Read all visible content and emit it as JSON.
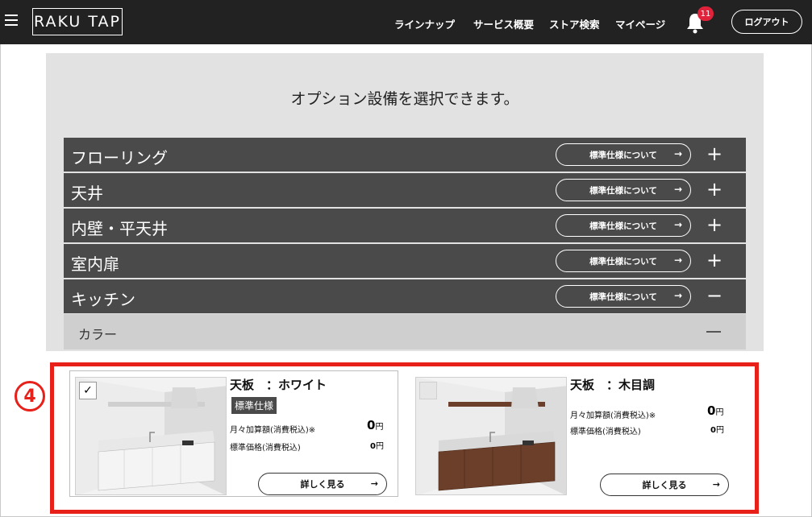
{
  "header": {
    "logo": "RAKU TAP",
    "nav": [
      "ラインナップ",
      "サービス概要",
      "ストア検索",
      "マイページ"
    ],
    "notification_count": "11",
    "logout_label": "ログアウト"
  },
  "main": {
    "intro": "オプション設備を選択できます。",
    "standard_button_label": "標準仕様について",
    "categories": [
      {
        "label": "フローリング",
        "toggle": "+"
      },
      {
        "label": "天井",
        "toggle": "+"
      },
      {
        "label": "内壁・平天井",
        "toggle": "+"
      },
      {
        "label": "室内扉",
        "toggle": "+"
      },
      {
        "label": "キッチン",
        "toggle": "−"
      }
    ],
    "sub_category": {
      "label": "カラー"
    },
    "step_marker": "4"
  },
  "options": [
    {
      "title": "天板　：ホワイト",
      "tag": "標準仕様",
      "checked": true,
      "monthly_label": "月々加算額(消費税込)※",
      "monthly_value": "0",
      "price_label": "標準価格(消費税込)",
      "price_value": "0",
      "unit": "円",
      "detail_label": "詳しく見る",
      "cabinet_color": "#f4f4f4"
    },
    {
      "title": "天板　：木目調",
      "tag": "",
      "checked": false,
      "monthly_label": "月々加算額(消費税込)※",
      "monthly_value": "0",
      "price_label": "標準価格(消費税込)",
      "price_value": "0",
      "unit": "円",
      "detail_label": "詳しく見る",
      "cabinet_color": "#6b3f2a"
    }
  ],
  "colors": {
    "header_bg": "#222222",
    "category_bg": "#4a4a4a",
    "panel_bg": "#e2e2e2",
    "highlight": "#e8201a",
    "badge": "#e0233a"
  }
}
